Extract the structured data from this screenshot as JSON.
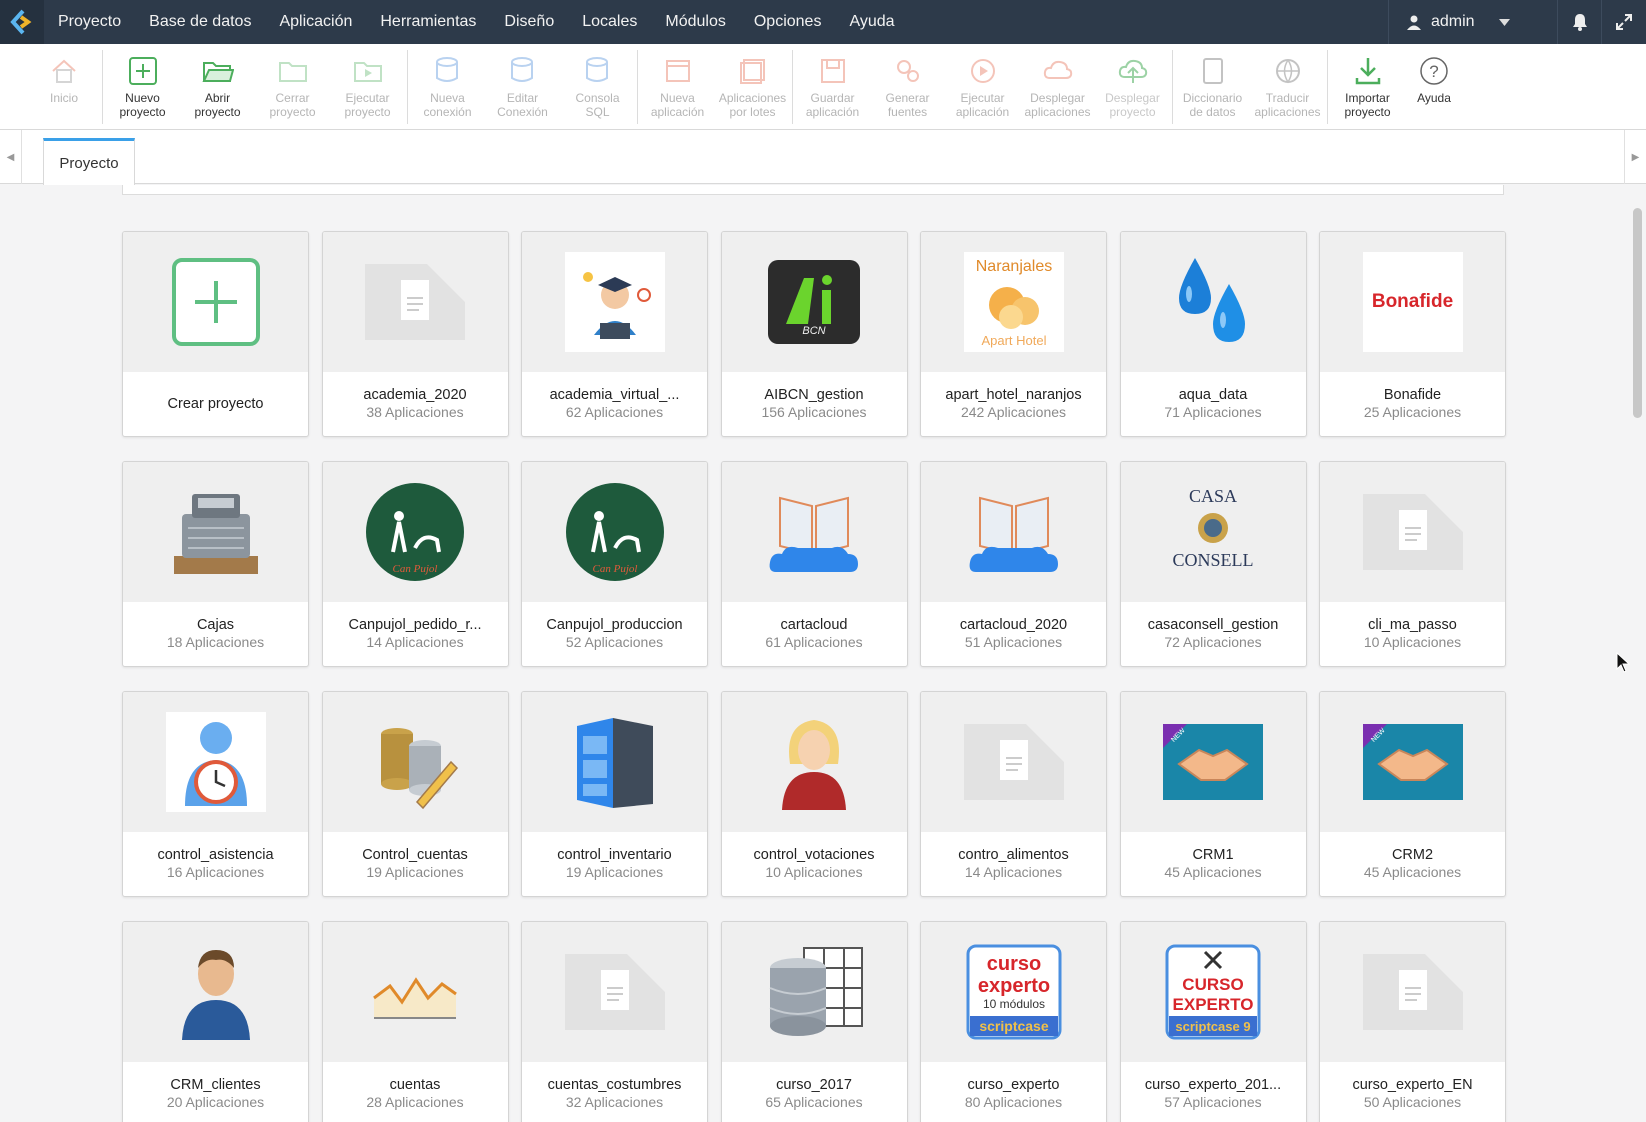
{
  "menu": {
    "items": [
      "Proyecto",
      "Base de datos",
      "Aplicación",
      "Herramientas",
      "Diseño",
      "Locales",
      "Módulos",
      "Opciones",
      "Ayuda"
    ],
    "user": "admin"
  },
  "toolbar": {
    "inicio": "Inicio",
    "nuevo_proyecto": "Nuevo\nproyecto",
    "abrir_proyecto": "Abrir\nproyecto",
    "cerrar_proyecto": "Cerrar\nproyecto",
    "ejecutar_proyecto": "Ejecutar\nproyecto",
    "nueva_conexion": "Nueva\nconexión",
    "editar_conexion": "Editar\nConexión",
    "consola_sql": "Consola\nSQL",
    "nueva_aplicacion": "Nueva\naplicación",
    "aplicaciones_lotes": "Aplicaciones\npor lotes",
    "guardar_aplicacion": "Guardar\naplicación",
    "generar_fuentes": "Generar\nfuentes",
    "ejecutar_aplicacion": "Ejecutar\naplicación",
    "desplegar_aplicaciones": "Desplegar\naplicaciones",
    "desplegar_proyecto": "Desplegar\nproyecto",
    "diccionario_datos": "Diccionario\nde datos",
    "traducir_aplicaciones": "Traducir\naplicaciones",
    "importar_proyecto": "Importar\nproyecto",
    "ayuda": "Ayuda"
  },
  "tab": {
    "label": "Proyecto"
  },
  "cards": {
    "c0": {
      "name": "Crear proyecto"
    },
    "c1": {
      "name": "academia_2020",
      "apps": "38 Aplicaciones"
    },
    "c2": {
      "name": "academia_virtual_...",
      "apps": "62 Aplicaciones"
    },
    "c3": {
      "name": "AIBCN_gestion",
      "apps": "156 Aplicaciones",
      "logo_text": "BCN"
    },
    "c4": {
      "name": "apart_hotel_naranjos",
      "apps": "242 Aplicaciones",
      "logo_top": "Naranjales",
      "logo_bottom": "Apart Hotel"
    },
    "c5": {
      "name": "aqua_data",
      "apps": "71 Aplicaciones"
    },
    "c6": {
      "name": "Bonafide",
      "apps": "25 Aplicaciones",
      "logo_text": "Bonafide"
    },
    "c7": {
      "name": "Cajas",
      "apps": "18 Aplicaciones"
    },
    "c8": {
      "name": "Canpujol_pedido_r...",
      "apps": "14 Aplicaciones",
      "logo_text": "Can Pujol"
    },
    "c9": {
      "name": "Canpujol_produccion",
      "apps": "52 Aplicaciones",
      "logo_text": "Can Pujol"
    },
    "c10": {
      "name": "cartacloud",
      "apps": "61 Aplicaciones"
    },
    "c11": {
      "name": "cartacloud_2020",
      "apps": "51 Aplicaciones"
    },
    "c12": {
      "name": "casaconsell_gestion",
      "apps": "72 Aplicaciones",
      "logo_top": "CASA",
      "logo_bottom": "CONSELL"
    },
    "c13": {
      "name": "cli_ma_passo",
      "apps": "10 Aplicaciones"
    },
    "c14": {
      "name": "control_asistencia",
      "apps": "16 Aplicaciones"
    },
    "c15": {
      "name": "Control_cuentas",
      "apps": "19 Aplicaciones"
    },
    "c16": {
      "name": "control_inventario",
      "apps": "19 Aplicaciones"
    },
    "c17": {
      "name": "control_votaciones",
      "apps": "10 Aplicaciones"
    },
    "c18": {
      "name": "contro_alimentos",
      "apps": "14 Aplicaciones"
    },
    "c19": {
      "name": "CRM1",
      "apps": "45 Aplicaciones",
      "badge": "NEW"
    },
    "c20": {
      "name": "CRM2",
      "apps": "45 Aplicaciones",
      "badge": "NEW"
    },
    "c21": {
      "name": "CRM_clientes",
      "apps": "20 Aplicaciones"
    },
    "c22": {
      "name": "cuentas",
      "apps": "28 Aplicaciones"
    },
    "c23": {
      "name": "cuentas_costumbres",
      "apps": "32 Aplicaciones"
    },
    "c24": {
      "name": "curso_2017",
      "apps": "65 Aplicaciones"
    },
    "c25": {
      "name": "curso_experto",
      "apps": "80 Aplicaciones",
      "logo_l1": "curso",
      "logo_l2": "experto",
      "logo_l3": "10 módulos",
      "logo_l4": "scriptcase"
    },
    "c26": {
      "name": "curso_experto_201...",
      "apps": "57 Aplicaciones",
      "logo_l1": "CURSO",
      "logo_l2": "EXPERTO",
      "logo_l4": "scriptcase 9"
    },
    "c27": {
      "name": "curso_experto_EN",
      "apps": "50 Aplicaciones"
    }
  },
  "colors": {
    "menubar": "#2d3a4a",
    "accent": "#3aa0e8",
    "green": "#4cae5c",
    "bonafide_red": "#d7262b",
    "crm_teal": "#1a86a8"
  }
}
